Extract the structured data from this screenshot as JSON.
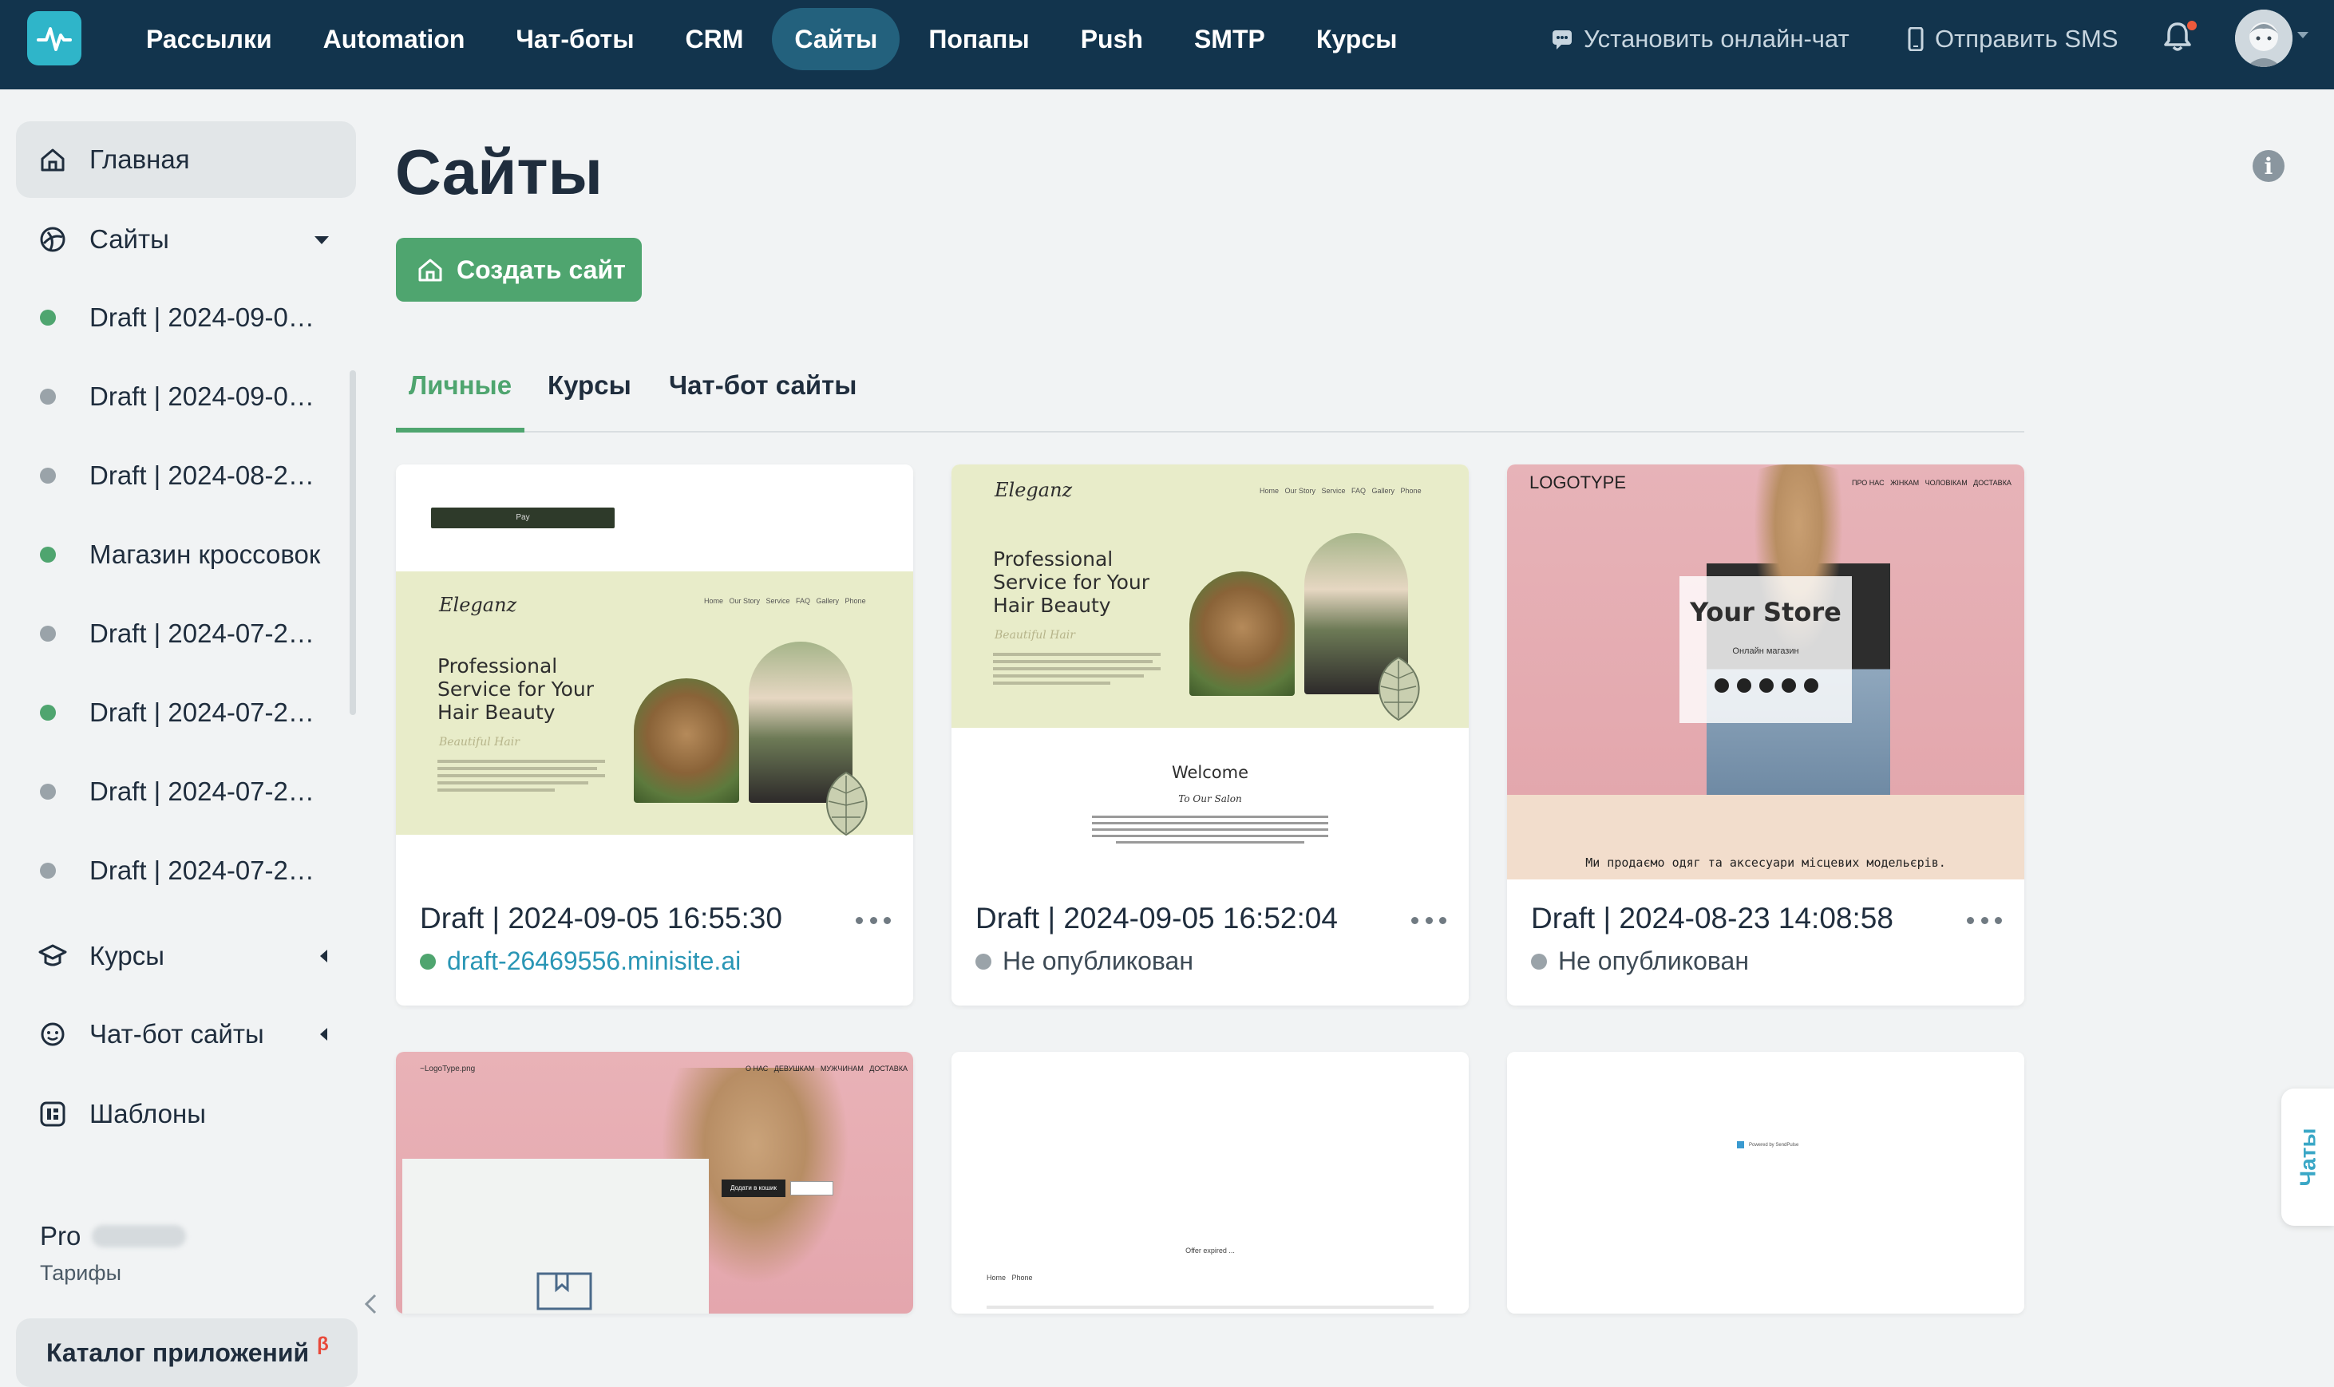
{
  "topbar": {
    "logo_icon": "pulse-logo-icon",
    "nav": [
      {
        "label": "Рассылки",
        "active": false
      },
      {
        "label": "Automation",
        "active": false
      },
      {
        "label": "Чат-боты",
        "active": false
      },
      {
        "label": "CRM",
        "active": false
      },
      {
        "label": "Сайты",
        "active": true
      },
      {
        "label": "Попапы",
        "active": false
      },
      {
        "label": "Push",
        "active": false
      },
      {
        "label": "SMTP",
        "active": false
      },
      {
        "label": "Курсы",
        "active": false
      }
    ],
    "install_chat_label": "Установить онлайн-чат",
    "send_sms_label": "Отправить SMS"
  },
  "sidebar": {
    "home_label": "Главная",
    "sites_label": "Сайты",
    "sites": [
      {
        "label": "Draft | 2024-09-05 16:55:30",
        "published": true
      },
      {
        "label": "Draft | 2024-09-05 16:52:04",
        "published": false
      },
      {
        "label": "Draft | 2024-08-23 14:08:58",
        "published": false
      },
      {
        "label": "Магазин кроссовок",
        "published": true
      },
      {
        "label": "Draft | 2024-07-2…",
        "published": false
      },
      {
        "label": "Draft | 2024-07-2…",
        "published": true
      },
      {
        "label": "Draft | 2024-07-2…",
        "published": false
      },
      {
        "label": "Draft | 2024-07-2…",
        "published": false
      }
    ],
    "courses_label": "Курсы",
    "chatbot_sites_label": "Чат-бот сайты",
    "templates_label": "Шаблоны",
    "pro_label": "Pro",
    "tariffs_label": "Тарифы",
    "catalog_label": "Каталог приложений",
    "beta_label": "β"
  },
  "main": {
    "title": "Сайты",
    "create_button": "Создать сайт",
    "tabs": [
      {
        "label": "Личные",
        "active": true
      },
      {
        "label": "Курсы",
        "active": false
      },
      {
        "label": "Чат-бот сайты",
        "active": false
      }
    ],
    "cards": [
      {
        "name": "Draft | 2024-09-05 16:55:30",
        "status": "draft-26469556.minisite.ai",
        "published": true
      },
      {
        "name": "Draft | 2024-09-05 16:52:04",
        "status": "Не опубликован",
        "published": false
      },
      {
        "name": "Draft | 2024-08-23 14:08:58",
        "status": "Не опубликован",
        "published": false
      }
    ],
    "thumbs": {
      "pay": "Pay",
      "brand": "Eleganz",
      "nav": "Home   Our Story   Service   FAQ   Gallery   Phone",
      "hero": [
        "Professional",
        "Service for Your",
        "Hair Beauty"
      ],
      "script": "Beautiful Hair",
      "welcome": "Welcome",
      "welcome_sub": "To Our Salon",
      "logotype": "LOGOTYPE",
      "store_nav": "ПРО НАС   ЖІНКАМ   ЧОЛОВІКАМ   ДОСТАВКА",
      "store_title": "Your Store",
      "store_sub": "Онлайн магазин",
      "store_footer": "Ми продаємо одяг та аксесуари місцевих модельєрів.",
      "logo_png": "~LogoType.png",
      "store2_nav": "О НАС   ДЕВУШКАМ   МУЖЧИНАМ   ДОСТАВКА",
      "add_to_cart": "Додати в кошик",
      "offer": "Offer expired ...",
      "home_phone": "Home   Phone",
      "powered": "Powered by SendPulse"
    }
  },
  "chats_tab": "Чаты",
  "colors": {
    "topbar": "#12344d",
    "accent": "#4fa56f",
    "link": "#2a96b5",
    "published": "#4fa56f",
    "unpublished": "#9aa3a9"
  }
}
